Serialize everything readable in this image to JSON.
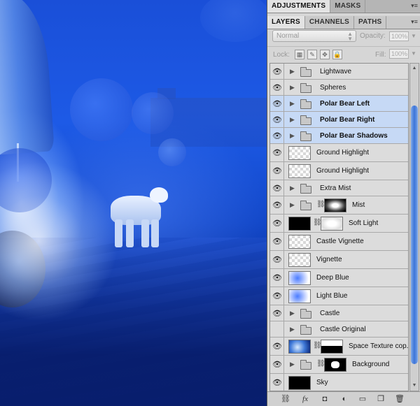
{
  "panels": {
    "top_tabs": [
      {
        "label": "ADJUSTMENTS",
        "active": true
      },
      {
        "label": "MASKS",
        "active": false
      }
    ],
    "layer_tabs": [
      {
        "label": "LAYERS",
        "active": true
      },
      {
        "label": "CHANNELS",
        "active": false
      },
      {
        "label": "PATHS",
        "active": false
      }
    ],
    "blend_mode": "Normal",
    "opacity_label": "Opacity:",
    "opacity_value": "100%",
    "lock_label": "Lock:",
    "fill_label": "Fill:",
    "fill_value": "100%"
  },
  "layers": [
    {
      "name": "Lightwave",
      "type": "group",
      "visible": true,
      "selected": false
    },
    {
      "name": "Spheres",
      "type": "group",
      "visible": true,
      "selected": false
    },
    {
      "name": "Polar Bear Left",
      "type": "group",
      "visible": true,
      "selected": true
    },
    {
      "name": "Polar Bear Right",
      "type": "group",
      "visible": true,
      "selected": true
    },
    {
      "name": "Polar Bear Shadows",
      "type": "group",
      "visible": true,
      "selected": true
    },
    {
      "name": "Ground Highlight",
      "type": "layer",
      "thumb": "transparent",
      "visible": true,
      "selected": false
    },
    {
      "name": "Ground Highlight",
      "type": "layer",
      "thumb": "transparent",
      "visible": true,
      "selected": false
    },
    {
      "name": "Extra Mist",
      "type": "group",
      "visible": true,
      "selected": false
    },
    {
      "name": "Mist",
      "type": "group-mask",
      "mask": "mask-mist",
      "visible": true,
      "selected": false
    },
    {
      "name": "Soft Light",
      "type": "layer-mask",
      "thumb": "black",
      "mask": "mask-soft",
      "visible": true,
      "selected": false
    },
    {
      "name": "Castle Vignette",
      "type": "layer",
      "thumb": "transparent",
      "visible": true,
      "selected": false
    },
    {
      "name": "Vignette",
      "type": "layer",
      "thumb": "transparent",
      "visible": true,
      "selected": false
    },
    {
      "name": "Deep Blue",
      "type": "layer",
      "thumb": "blue",
      "visible": true,
      "selected": false
    },
    {
      "name": "Light Blue",
      "type": "layer",
      "thumb": "blue",
      "visible": true,
      "selected": false
    },
    {
      "name": "Castle",
      "type": "group",
      "visible": true,
      "selected": false
    },
    {
      "name": "Castle Original",
      "type": "group",
      "visible": false,
      "selected": false
    },
    {
      "name": "Space Texture cop...",
      "type": "layer-mask",
      "thumb": "space",
      "mask": "mask-white",
      "visible": true,
      "selected": false
    },
    {
      "name": "Background",
      "type": "group-mask",
      "mask": "mask-bear",
      "visible": true,
      "selected": false
    },
    {
      "name": "Sky",
      "type": "layer",
      "thumb": "black",
      "visible": true,
      "selected": false
    }
  ],
  "bottom_icons": [
    "link-layers-icon",
    "fx-icon",
    "add-mask-icon",
    "adjustment-layer-icon",
    "new-group-icon",
    "new-layer-icon",
    "trash-icon"
  ],
  "colors": {
    "selection": "#c6d9f5",
    "scroll_thumb": "#3c74d8",
    "panel_bg": "#d6d6d6"
  }
}
